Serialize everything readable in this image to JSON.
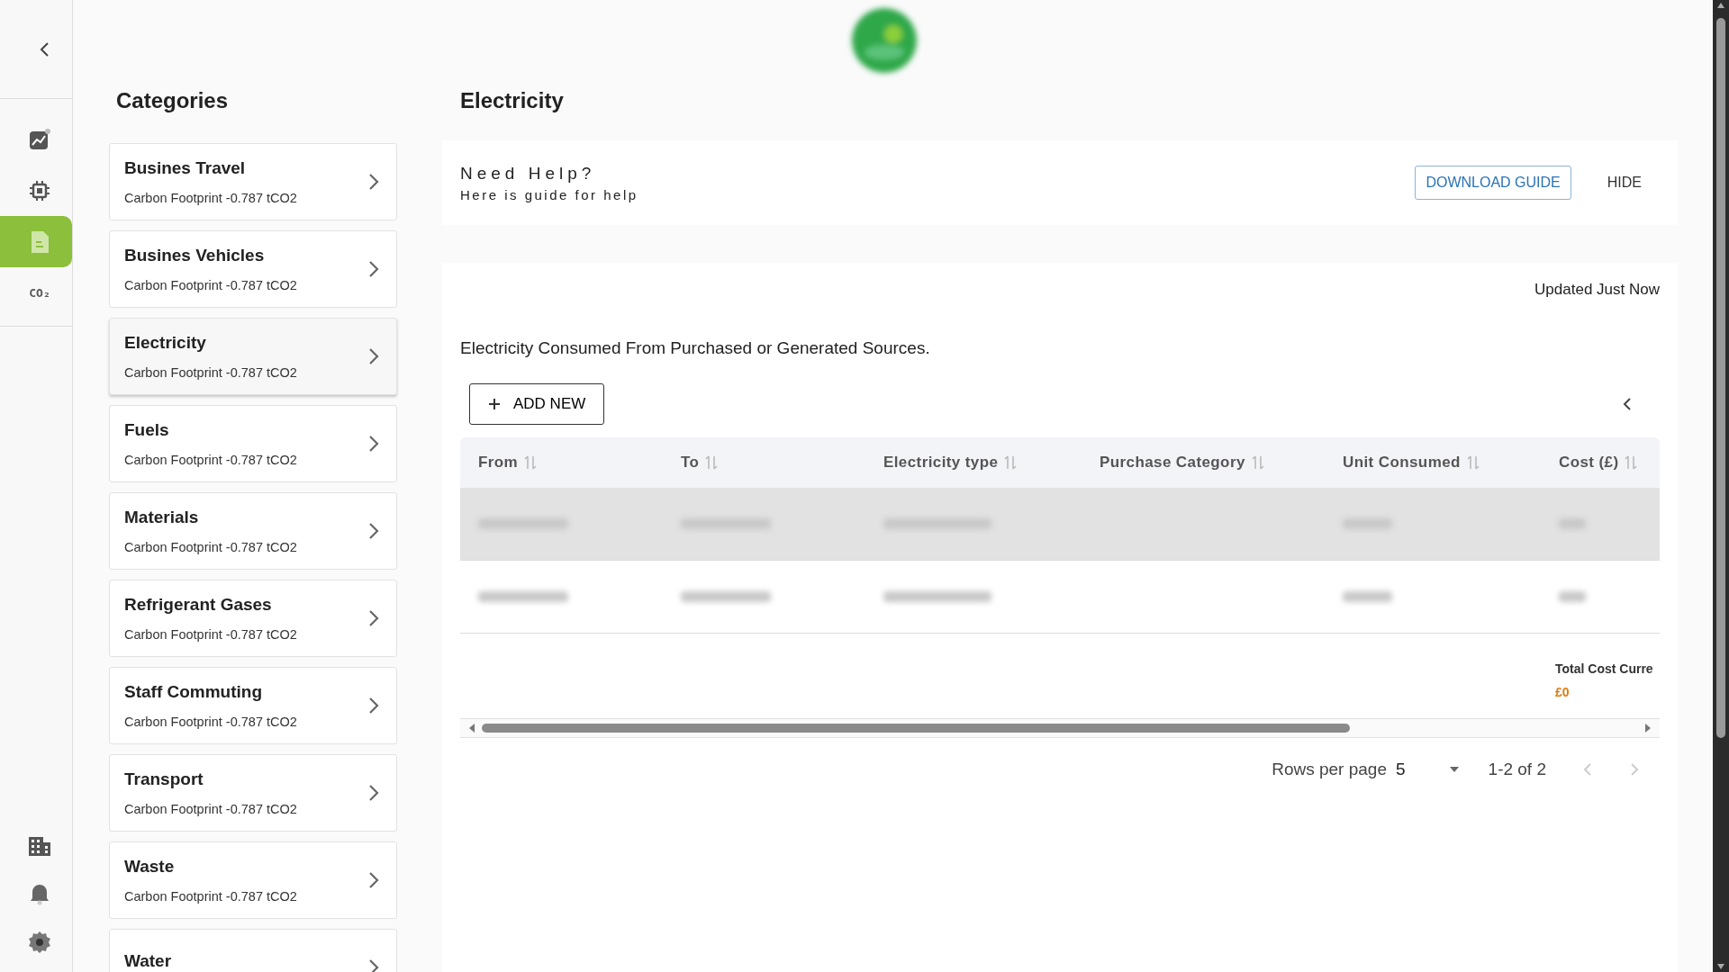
{
  "nav": {
    "top": [
      {
        "kind": "chart",
        "selected": false
      },
      {
        "kind": "chip",
        "selected": false
      },
      {
        "kind": "document",
        "selected": true
      },
      {
        "kind": "co2",
        "selected": false,
        "label": "CO₂"
      }
    ],
    "bottom": [
      {
        "kind": "building"
      },
      {
        "kind": "bell"
      },
      {
        "kind": "gear"
      }
    ]
  },
  "categories": {
    "title": "Categories",
    "items": [
      {
        "name": "Busines Travel",
        "subtitle": "Carbon Footprint -0.787 tCO2",
        "selected": false
      },
      {
        "name": "Busines Vehicles",
        "subtitle": "Carbon Footprint -0.787 tCO2",
        "selected": false
      },
      {
        "name": "Electricity",
        "subtitle": "Carbon Footprint -0.787 tCO2",
        "selected": true
      },
      {
        "name": "Fuels",
        "subtitle": "Carbon Footprint -0.787 tCO2",
        "selected": false
      },
      {
        "name": "Materials",
        "subtitle": "Carbon Footprint -0.787 tCO2",
        "selected": false
      },
      {
        "name": "Refrigerant Gases",
        "subtitle": "Carbon Footprint -0.787 tCO2",
        "selected": false
      },
      {
        "name": "Staff Commuting",
        "subtitle": "Carbon Footprint -0.787 tCO2",
        "selected": false
      },
      {
        "name": "Transport",
        "subtitle": "Carbon Footprint -0.787 tCO2",
        "selected": false
      },
      {
        "name": "Waste",
        "subtitle": "Carbon Footprint -0.787 tCO2",
        "selected": false
      },
      {
        "name": "Water",
        "selected": false
      }
    ]
  },
  "main": {
    "title": "Electricity",
    "help": {
      "title": "Need Help?",
      "subtitle": "Here is guide for help",
      "download": "DOWNLOAD GUIDE",
      "hide": "HIDE"
    },
    "updated": "Updated Just Now",
    "description": "Electricity Consumed From Purchased or Generated Sources.",
    "add_button": "ADD NEW",
    "table": {
      "columns": [
        "From",
        "To",
        "Electricity type",
        "Purchase Category",
        "Unit Consumed",
        "Cost (£)"
      ],
      "rows": [
        {
          "selected": true
        },
        {
          "selected": false
        }
      ],
      "total_label": "Total Cost Curre",
      "total_value": "£0"
    },
    "pagination": {
      "rows_per_page_label": "Rows per page",
      "rows_per_page": "5",
      "range": "1-2 of 2"
    }
  }
}
